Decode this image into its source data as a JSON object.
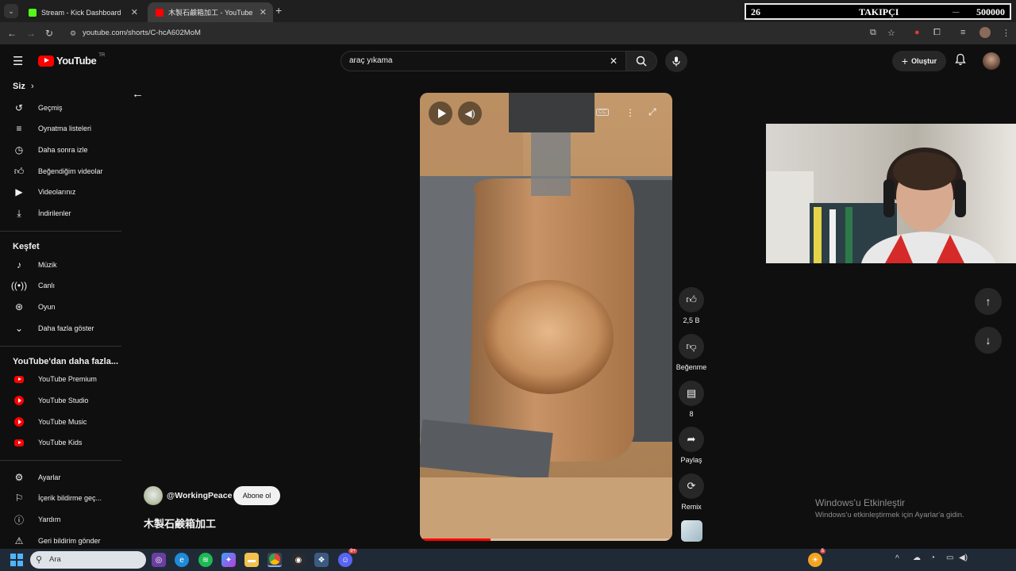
{
  "browser": {
    "tabs": [
      {
        "title": "Stream - Kick Dashboard",
        "favicon_color": "#53fc18"
      },
      {
        "title": "木製石鹸箱加工 - YouTube",
        "favicon_color": "#ff0000"
      }
    ],
    "new_tab": "+",
    "url": "youtube.com/shorts/C-hcA602MoM"
  },
  "follower_overlay": {
    "current": "26",
    "label": "TAKIPÇI",
    "goal": "500000"
  },
  "youtube": {
    "logo_text": "YouTube",
    "region": "TR",
    "search_value": "araç yıkama",
    "create_label": "Oluştur"
  },
  "sidebar": {
    "you_title": "Siz",
    "you_items": [
      {
        "label": "Geçmiş",
        "icon": "history-icon"
      },
      {
        "label": "Oynatma listeleri",
        "icon": "playlist-icon"
      },
      {
        "label": "Daha sonra izle",
        "icon": "clock-icon"
      },
      {
        "label": "Beğendiğim videolar",
        "icon": "thumbs-up-icon"
      },
      {
        "label": "Videolarınız",
        "icon": "video-icon"
      },
      {
        "label": "İndirilenler",
        "icon": "download-icon"
      }
    ],
    "explore_title": "Keşfet",
    "explore_items": [
      {
        "label": "Müzik",
        "icon": "music-icon"
      },
      {
        "label": "Canlı",
        "icon": "live-icon"
      },
      {
        "label": "Oyun",
        "icon": "gaming-icon"
      },
      {
        "label": "Daha fazla göster",
        "icon": "chevron-down-icon"
      }
    ],
    "more_title": "YouTube'dan daha fazla...",
    "more_items": [
      {
        "label": "YouTube Premium"
      },
      {
        "label": "YouTube Studio"
      },
      {
        "label": "YouTube Music"
      },
      {
        "label": "YouTube Kids"
      }
    ],
    "settings_items": [
      {
        "label": "Ayarlar",
        "icon": "gear-icon"
      },
      {
        "label": "İçerik bildirme geç...",
        "icon": "flag-icon"
      },
      {
        "label": "Yardım",
        "icon": "help-icon"
      },
      {
        "label": "Geri bildirim gönder",
        "icon": "feedback-icon"
      }
    ]
  },
  "short": {
    "channel": "@WorkingPeace",
    "subscribe_label": "Abone ol",
    "title": "木製石鹸箱加工",
    "likes": "2,5 B",
    "dislike_label": "Beğenme",
    "comments": "8",
    "share_label": "Paylaş",
    "remix_label": "Remix",
    "progress": 0.28
  },
  "windows": {
    "activation_title": "Windows'u Etkinleştir",
    "activation_sub": "Windows'u etkinleştirmek için Ayarlar'a gidin.",
    "search_placeholder": "Ara",
    "weather_badge": "5",
    "discord_badge": "9+"
  }
}
